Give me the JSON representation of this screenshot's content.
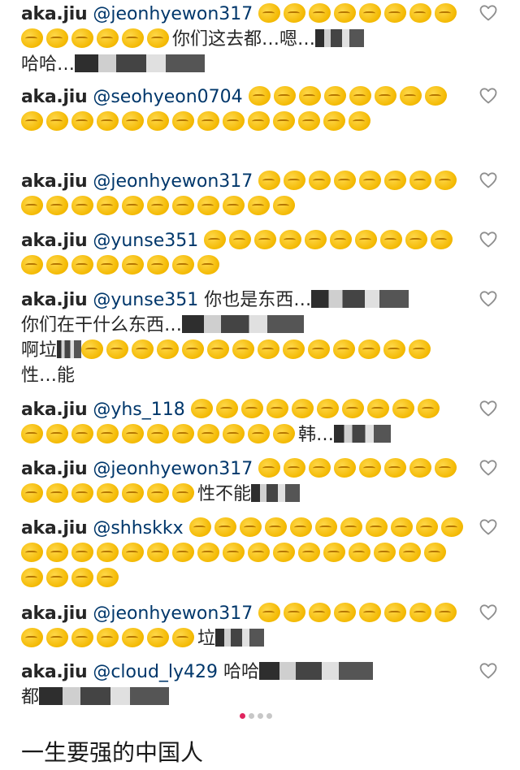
{
  "comments": [
    {
      "user": "aka.jiu",
      "mention": "@jeonhyewon317",
      "text_before": "",
      "text_after": "你们这去都…嗯…",
      "blur_tail": "哈哈…",
      "emojis": 14
    },
    {
      "user": "aka.jiu",
      "mention": "@seohyeon0704",
      "text_before": "",
      "text_after": "",
      "blur_tail": "",
      "emojis": 22
    },
    {
      "user": "aka.jiu",
      "mention": "@jeonhyewon317",
      "text_before": "",
      "text_after": "",
      "blur_tail": "",
      "emojis": 19
    },
    {
      "user": "aka.jiu",
      "mention": "@yunse351",
      "text_before": "",
      "text_after": "",
      "blur_tail": "",
      "emojis": 18
    },
    {
      "user": "aka.jiu",
      "mention": "@yunse351",
      "text_before": "",
      "text_after": "",
      "blur_tail": "",
      "emojis": 14
    },
    {
      "user": "aka.jiu",
      "mention": "@yhs_118",
      "text_before": "",
      "text_after": "",
      "blur_tail": "",
      "emojis": 21
    },
    {
      "user": "aka.jiu",
      "mention": "@jeonhyewon317",
      "text_before": "",
      "text_after": "性不能",
      "blur_tail": "",
      "emojis": 15
    },
    {
      "user": "aka.jiu",
      "mention": "@shhskkx",
      "text_before": "",
      "text_after": "",
      "blur_tail": "",
      "emojis": 32
    },
    {
      "user": "aka.jiu",
      "mention": "@jeonhyewon317",
      "text_before": "",
      "text_after": "垃",
      "blur_tail": "",
      "emojis": 15
    },
    {
      "user": "aka.jiu",
      "mention": "@cloud_ly429",
      "text_before": "",
      "text_after": "哈哈",
      "blur_tail": "都",
      "emojis": 0
    }
  ],
  "special_texts": {
    "c4_line1": "你也是东西…",
    "c4_line2": "你们在干什么东西…",
    "c4_line3": "啊垃",
    "c4_line4": "性…能",
    "c5_tail": "韩…"
  },
  "carousel": {
    "count": 4,
    "active_index": 0
  },
  "caption": "一生要强的中国人",
  "colors": {
    "mention": "#00376b",
    "dot_active": "#e0245e",
    "dot_inactive": "#c7c7c7"
  }
}
